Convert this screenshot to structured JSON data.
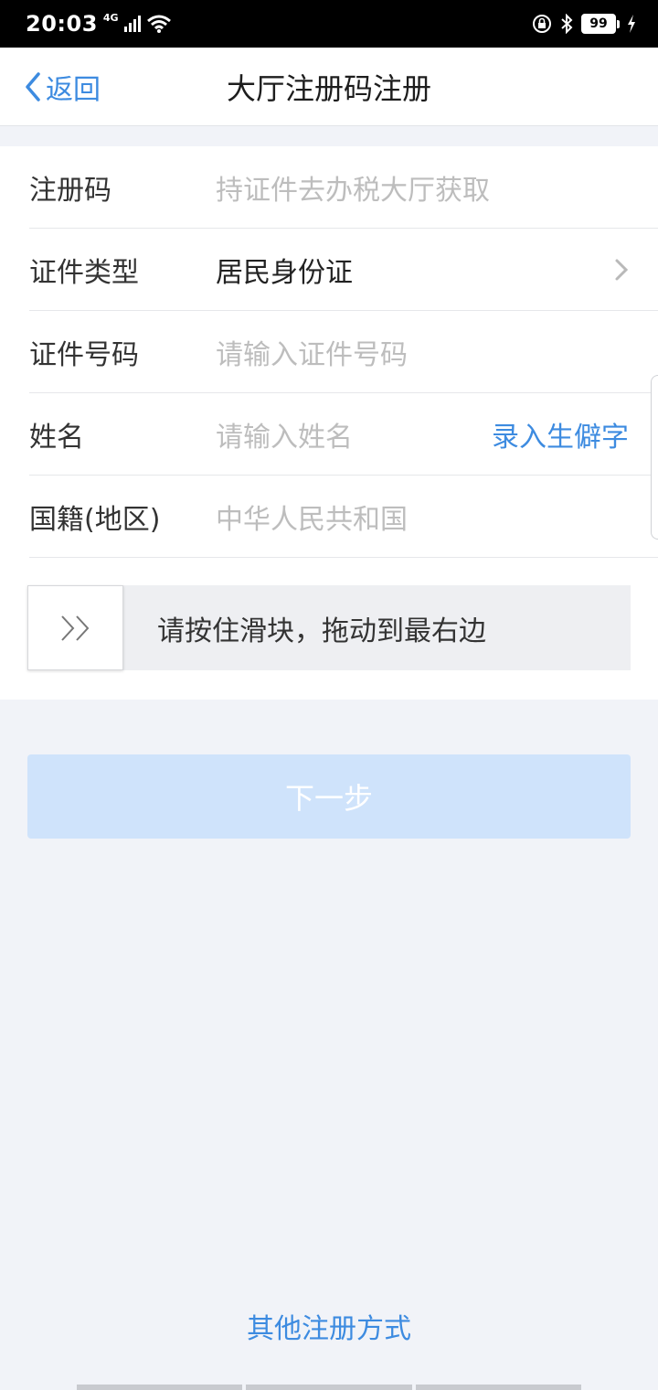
{
  "status_bar": {
    "time": "20:03",
    "network": "4G",
    "battery": "99"
  },
  "nav": {
    "back_label": "返回",
    "title": "大厅注册码注册"
  },
  "form": {
    "rows": [
      {
        "label": "注册码",
        "placeholder": "持证件去办税大厅获取"
      },
      {
        "label": "证件类型",
        "value": "居民身份证"
      },
      {
        "label": "证件号码",
        "placeholder": "请输入证件号码"
      },
      {
        "label": "姓名",
        "placeholder": "请输入姓名",
        "action": "录入生僻字"
      },
      {
        "label": "国籍(地区)",
        "placeholder": "中华人民共和国"
      }
    ]
  },
  "slider": {
    "text": "请按住滑块，拖动到最右边",
    "progress": 0
  },
  "next_button": "下一步",
  "other_methods_link": "其他注册方式",
  "colors": {
    "accent": "#3d8be0",
    "disabled_button": "#cfe3fb",
    "background": "#f1f3f8"
  },
  "icons": [
    "chevron-left-icon",
    "chevron-right-icon",
    "double-chevron-right-icon",
    "signal-icon",
    "wifi-icon",
    "lock-rotation-icon",
    "bluetooth-icon",
    "battery-icon",
    "charging-icon"
  ]
}
